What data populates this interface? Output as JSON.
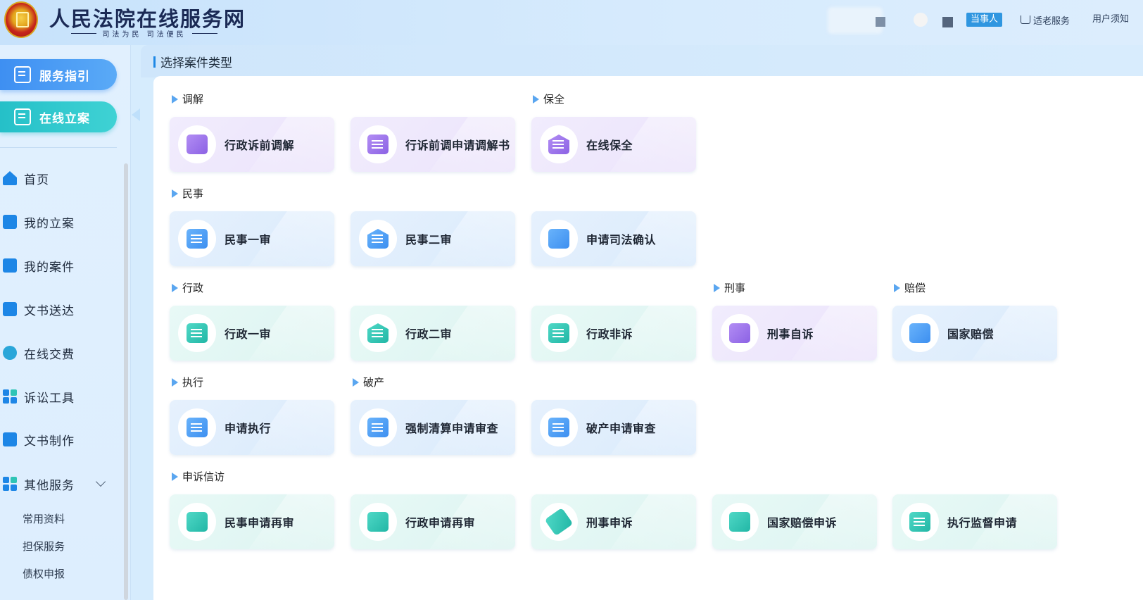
{
  "header": {
    "site_title": "人民法院在线服务网",
    "site_slogan": "司法为民  司法便民",
    "role_badge": "当事人",
    "elder_service": "适老服务",
    "user_notice": "用户须知"
  },
  "sidebar": {
    "guide_button": "服务指引",
    "online_filing_button": "在线立案",
    "nav": [
      {
        "label": "首页",
        "icon": "home-icon"
      },
      {
        "label": "我的立案",
        "icon": "edit-doc-icon"
      },
      {
        "label": "我的案件",
        "icon": "clipboard-icon"
      },
      {
        "label": "文书送达",
        "icon": "monitor-check-icon"
      },
      {
        "label": "在线交费",
        "icon": "payment-icon"
      },
      {
        "label": "诉讼工具",
        "icon": "tools-icon"
      },
      {
        "label": "文书制作",
        "icon": "doc-search-icon"
      },
      {
        "label": "其他服务",
        "icon": "apps-icon"
      }
    ],
    "sub_items": [
      "常用资料",
      "担保服务",
      "债权申报"
    ]
  },
  "main": {
    "title": "选择案件类型",
    "sections": {
      "mediation": {
        "label": "调解",
        "cards": [
          "行政诉前调解",
          "行诉前调申请调解书"
        ]
      },
      "preservation": {
        "label": "保全",
        "cards": [
          "在线保全"
        ]
      },
      "civil": {
        "label": "民事",
        "cards": [
          "民事一审",
          "民事二审",
          "申请司法确认"
        ]
      },
      "administrative": {
        "label": "行政",
        "cards": [
          "行政一审",
          "行政二审",
          "行政非诉"
        ]
      },
      "criminal": {
        "label": "刑事",
        "cards": [
          "刑事自诉"
        ]
      },
      "compensation": {
        "label": "赔偿",
        "cards": [
          "国家赔偿"
        ]
      },
      "execution": {
        "label": "执行",
        "cards": [
          "申请执行"
        ]
      },
      "bankruptcy": {
        "label": "破产",
        "cards": [
          "强制清算申请审查",
          "破产申请审查"
        ]
      },
      "petition": {
        "label": "申诉信访",
        "cards": [
          "民事申请再审",
          "行政申请再审",
          "刑事申诉",
          "国家赔偿申诉",
          "执行监督申请"
        ]
      }
    }
  },
  "colors": {
    "accent_blue": "#3e8ff2",
    "accent_teal": "#25c0c8",
    "badge": "#2f96e0"
  }
}
